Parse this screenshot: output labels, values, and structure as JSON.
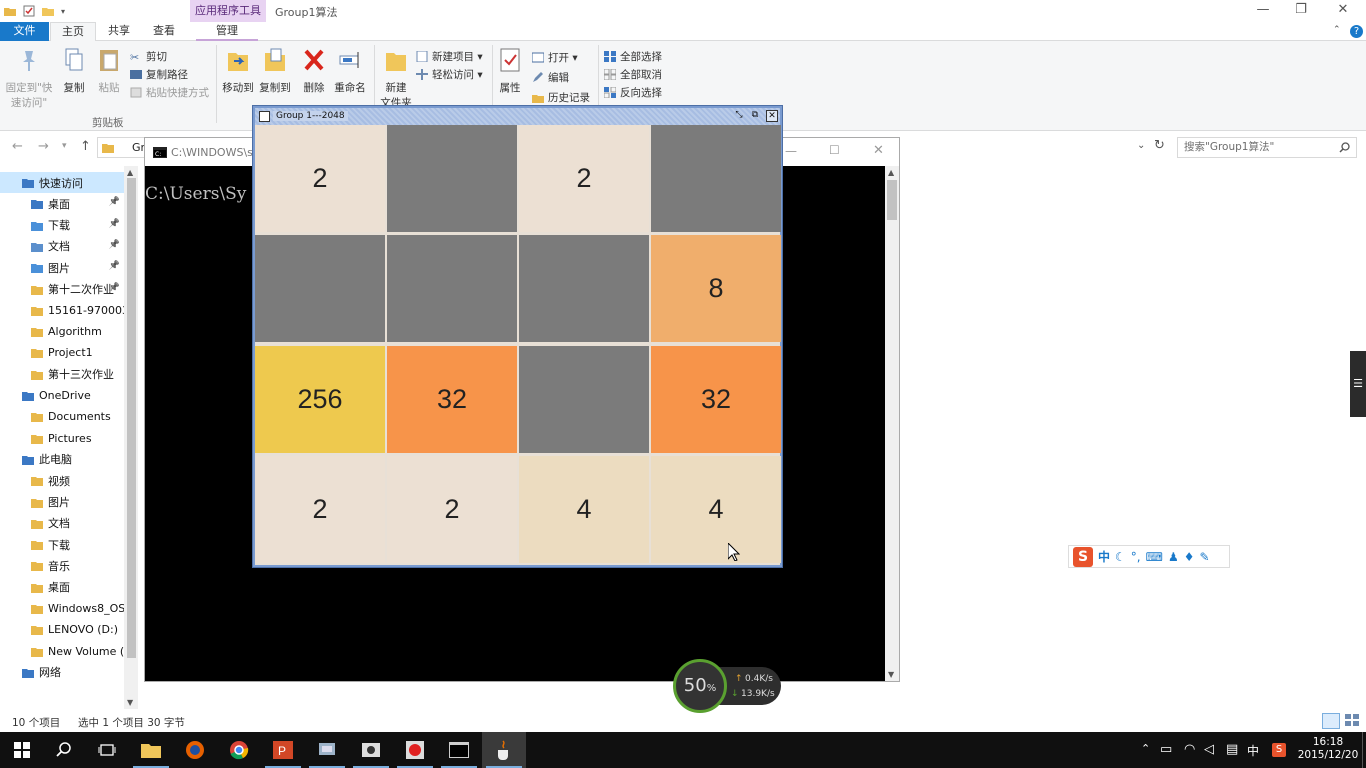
{
  "explorer": {
    "title": "Group1算法",
    "contextual_tab": "应用程序工具",
    "tabs": [
      "文件",
      "主页",
      "共享",
      "查看",
      "管理"
    ],
    "ribbon": {
      "pin_quick_access": "固定到\"快速访问\"",
      "copy": "复制",
      "paste": "粘贴",
      "cut": "剪切",
      "copy_path": "复制路径",
      "paste_shortcut": "粘贴快捷方式",
      "clipboard_group": "剪贴板",
      "move_to": "移动到",
      "copy_to": "复制到",
      "delete": "删除",
      "rename": "重命名",
      "new_folder": "新建\n文件夹",
      "new_item": "新建项目 ▾",
      "easy_access": "轻松访问 ▾",
      "properties": "属性",
      "open": "打开 ▾",
      "edit": "编辑",
      "history": "历史记录",
      "select_all": "全部选择",
      "select_none": "全部取消",
      "invert_selection": "反向选择"
    },
    "address_fragment": "Gr",
    "search_placeholder": "搜索\"Group1算法\"",
    "nav_items": [
      {
        "label": "快速访问",
        "level": 0,
        "selected": true,
        "pinned": false
      },
      {
        "label": "桌面",
        "level": 1,
        "pinned": true
      },
      {
        "label": "下载",
        "level": 1,
        "pinned": true
      },
      {
        "label": "文档",
        "level": 1,
        "pinned": true
      },
      {
        "label": "图片",
        "level": 1,
        "pinned": true
      },
      {
        "label": "第十二次作业",
        "level": 1,
        "pinned": true
      },
      {
        "label": "15161-970003-",
        "level": 1,
        "pinned": false
      },
      {
        "label": "Algorithm",
        "level": 1,
        "pinned": false
      },
      {
        "label": "Project1",
        "level": 1,
        "pinned": false
      },
      {
        "label": "第十三次作业",
        "level": 1,
        "pinned": false
      },
      {
        "label": "OneDrive",
        "level": 0,
        "pinned": false
      },
      {
        "label": "Documents",
        "level": 1,
        "pinned": false
      },
      {
        "label": "Pictures",
        "level": 1,
        "pinned": false
      },
      {
        "label": "此电脑",
        "level": 0,
        "pinned": false
      },
      {
        "label": "视频",
        "level": 1,
        "pinned": false
      },
      {
        "label": "图片",
        "level": 1,
        "pinned": false
      },
      {
        "label": "文档",
        "level": 1,
        "pinned": false
      },
      {
        "label": "下载",
        "level": 1,
        "pinned": false
      },
      {
        "label": "音乐",
        "level": 1,
        "pinned": false
      },
      {
        "label": "桌面",
        "level": 1,
        "pinned": false
      },
      {
        "label": "Windows8_OS",
        "level": 1,
        "pinned": false
      },
      {
        "label": "LENOVO (D:)",
        "level": 1,
        "pinned": false
      },
      {
        "label": "New Volume (E",
        "level": 1,
        "pinned": false
      },
      {
        "label": "网络",
        "level": 0,
        "pinned": false
      }
    ],
    "status": {
      "item_count": "10 个项目",
      "selection": "选中 1 个项目  30 字节"
    }
  },
  "console": {
    "title": "C:\\WINDOWS\\s",
    "prompt": "C:\\Users\\Sy"
  },
  "game": {
    "title": "Group 1---2048",
    "board": [
      [
        "2",
        "",
        "2",
        ""
      ],
      [
        "",
        "",
        "",
        "8"
      ],
      [
        "256",
        "32",
        "",
        "32"
      ],
      [
        "2",
        "2",
        "4",
        "4"
      ]
    ],
    "tile_colors": {
      "empty": "#7b7b7b",
      "2": "#ece0d3",
      "4": "#ecdcc0",
      "8": "#f0ae6c",
      "32": "#f7944a",
      "256": "#eec94e"
    }
  },
  "ime": {
    "logo": "S",
    "mode": "中"
  },
  "netmon": {
    "percent": "50",
    "unit": "%",
    "up": "0.4K/s",
    "down": "13.9K/s"
  },
  "taskbar": {
    "tray_ime": "中",
    "time": "16:18",
    "date": "2015/12/20"
  },
  "colors": {
    "accent": "#1979ca",
    "selection": "#cce8ff",
    "contextual_tab": "#e8d3f2"
  }
}
